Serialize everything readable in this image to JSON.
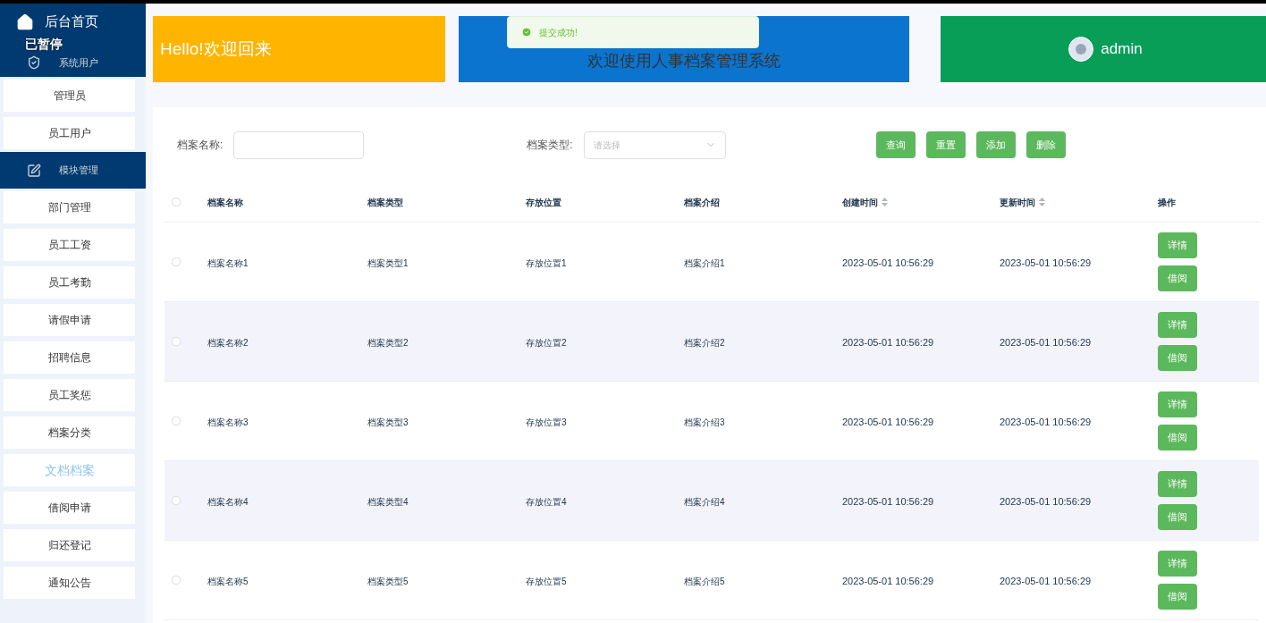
{
  "overlay_label": "已暂停",
  "sidebar": {
    "items": [
      {
        "kind": "home",
        "label": "后台首页",
        "selected": false
      },
      {
        "kind": "group",
        "label": "系统用户",
        "selected": false
      },
      {
        "kind": "item",
        "label": "管理员",
        "selected": false
      },
      {
        "kind": "item",
        "label": "员工用户",
        "selected": false
      },
      {
        "kind": "group",
        "label": "模块管理",
        "selected": false
      },
      {
        "kind": "item",
        "label": "部门管理",
        "selected": false
      },
      {
        "kind": "item",
        "label": "员工工资",
        "selected": false
      },
      {
        "kind": "item",
        "label": "员工考勤",
        "selected": false
      },
      {
        "kind": "item",
        "label": "请假申请",
        "selected": false
      },
      {
        "kind": "item",
        "label": "招聘信息",
        "selected": false
      },
      {
        "kind": "item",
        "label": "员工奖惩",
        "selected": false
      },
      {
        "kind": "item",
        "label": "档案分类",
        "selected": false
      },
      {
        "kind": "item",
        "label": "文档档案",
        "selected": true
      },
      {
        "kind": "item",
        "label": "借阅申请",
        "selected": false
      },
      {
        "kind": "item",
        "label": "归还登记",
        "selected": false
      },
      {
        "kind": "item",
        "label": "通知公告",
        "selected": false
      }
    ]
  },
  "banners": [
    {
      "kind": "greeting",
      "text": "Hello!欢迎回来",
      "color": "#ffb400"
    },
    {
      "kind": "title",
      "text": "欢迎使用人事档案管理系统",
      "color": "#0a74cf"
    },
    {
      "kind": "user",
      "text": "admin",
      "color": "#089e58"
    }
  ],
  "toast": {
    "message": "提交成功!"
  },
  "filters": [
    {
      "label": "档案名称:",
      "kind": "text"
    },
    {
      "label": "档案类型:",
      "kind": "select",
      "placeholder": "请选择"
    }
  ],
  "actions": [
    "查询",
    "重置",
    "添加",
    "删除"
  ],
  "table": {
    "all_checked": false,
    "columns": [
      {
        "label": "档案名称",
        "sortable": false
      },
      {
        "label": "档案类型",
        "sortable": false
      },
      {
        "label": "存放位置",
        "sortable": false
      },
      {
        "label": "档案介绍",
        "sortable": false
      },
      {
        "label": "创建时间",
        "sortable": true
      },
      {
        "label": "更新时间",
        "sortable": true
      },
      {
        "label": "操作",
        "sortable": false
      }
    ],
    "rows": [
      {
        "checked": false,
        "cells": [
          "档案名称1",
          "档案类型1",
          "存放位置1",
          "档案介绍1",
          "2023-05-01 10:56:29",
          "2023-05-01 10:56:29"
        ],
        "buttons": [
          "详情",
          "借阅"
        ]
      },
      {
        "checked": false,
        "cells": [
          "档案名称2",
          "档案类型2",
          "存放位置2",
          "档案介绍2",
          "2023-05-01 10:56:29",
          "2023-05-01 10:56:29"
        ],
        "buttons": [
          "详情",
          "借阅"
        ]
      },
      {
        "checked": false,
        "cells": [
          "档案名称3",
          "档案类型3",
          "存放位置3",
          "档案介绍3",
          "2023-05-01 10:56:29",
          "2023-05-01 10:56:29"
        ],
        "buttons": [
          "详情",
          "借阅"
        ]
      },
      {
        "checked": false,
        "cells": [
          "档案名称4",
          "档案类型4",
          "存放位置4",
          "档案介绍4",
          "2023-05-01 10:56:29",
          "2023-05-01 10:56:29"
        ],
        "buttons": [
          "详情",
          "借阅"
        ]
      },
      {
        "checked": false,
        "cells": [
          "档案名称5",
          "档案类型5",
          "存放位置5",
          "档案介绍5",
          "2023-05-01 10:56:29",
          "2023-05-01 10:56:29"
        ],
        "buttons": [
          "详情",
          "借阅"
        ]
      }
    ]
  }
}
